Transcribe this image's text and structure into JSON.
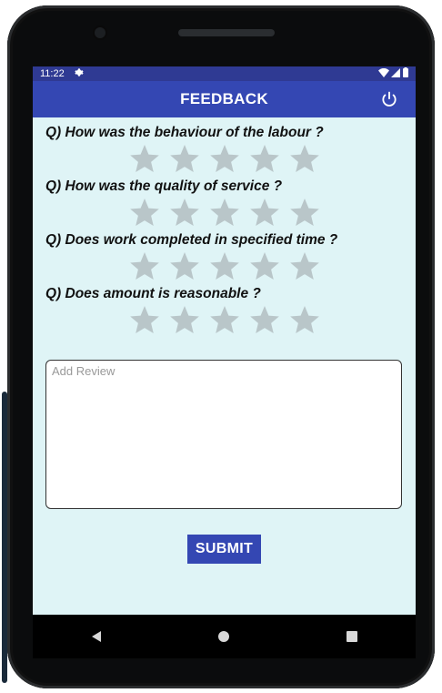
{
  "status_bar": {
    "time": "11:22"
  },
  "app_bar": {
    "title": "FEEDBACK"
  },
  "questions": [
    {
      "text": "Q) How was the behaviour of the labour ?",
      "rating": 0,
      "max": 5
    },
    {
      "text": "Q) How was the quality of service ?",
      "rating": 0,
      "max": 5
    },
    {
      "text": "Q) Does work completed in specified time ?",
      "rating": 0,
      "max": 5
    },
    {
      "text": "Q) Does amount is reasonable ?",
      "rating": 0,
      "max": 5
    }
  ],
  "review": {
    "placeholder": "Add Review",
    "value": ""
  },
  "submit_label": "SUBMIT",
  "colors": {
    "app_bar": "#3447b3",
    "status_bar": "#2f3a93",
    "screen_bg": "#dff4f6",
    "star_empty": "#b9c6c9",
    "submit": "#3447b3"
  },
  "icons": [
    "settings-icon",
    "wifi-icon",
    "signal-icon",
    "battery-icon",
    "power-icon",
    "back-icon",
    "home-icon",
    "recents-icon"
  ]
}
